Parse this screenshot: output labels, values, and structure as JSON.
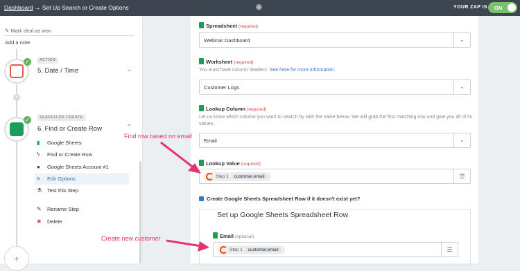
{
  "topbar": {
    "breadcrumb_link": "Dashboard",
    "breadcrumb_sep": "→",
    "breadcrumb_current": "Set Up Search or Create Options",
    "zap_label": "YOUR ZAP IS",
    "toggle_label": "ON"
  },
  "sidebar": {
    "prev_step": "Mark deal as won",
    "add_note": "Add a note",
    "steps": [
      {
        "tag": "ACTION",
        "title": "5. Date / Time"
      },
      {
        "tag": "SEARCH OR CREATE",
        "title": "6. Find or Create Row"
      }
    ],
    "plus": "+",
    "subitems": [
      {
        "label": "Google Sheets",
        "icon": "sheets-icon"
      },
      {
        "label": "Find or Create Row",
        "icon": "bolt-icon"
      },
      {
        "label": "Google Sheets Account #1",
        "icon": "person-icon"
      },
      {
        "label": "Edit Options",
        "icon": "list-icon"
      },
      {
        "label": "Test this Step",
        "icon": "flask-icon"
      },
      {
        "label": "Rename Step",
        "icon": "pencil-icon"
      },
      {
        "label": "Delete",
        "icon": "x-icon"
      }
    ]
  },
  "form": {
    "spreadsheet": {
      "label": "Spreadsheet",
      "required": "(required)",
      "value": "Webinar Dashboard"
    },
    "worksheet": {
      "label": "Worksheet",
      "required": "(required)",
      "help": "You must have column headers.",
      "help_link": "See here for more information.",
      "value": "Customer Logs"
    },
    "lookup_column": {
      "label": "Lookup Column",
      "required": "(required)",
      "help": "Let us know which column you want to search by with the value below. We will grab the first matching row and give you all of its values.",
      "value": "Email"
    },
    "lookup_value": {
      "label": "Lookup Value",
      "required": "(required)",
      "step": "Step 1",
      "value": "customer.email"
    },
    "create_checkbox": "Create Google Sheets Spreadsheet Row if it doesn't exist yet?",
    "create_section": {
      "title": "Set up Google Sheets Spreadsheet Row",
      "email": {
        "label": "Email",
        "optional": "(optional)",
        "step": "Step 1",
        "value": "customer.email"
      }
    }
  },
  "annotations": {
    "find_row": "Find row based on email",
    "create_customer": "Create new customer"
  },
  "colors": {
    "topbar": "#3d4551",
    "toggle": "#7bc06b",
    "annotation": "#e5336d",
    "sheets_green": "#1e9d5a"
  }
}
